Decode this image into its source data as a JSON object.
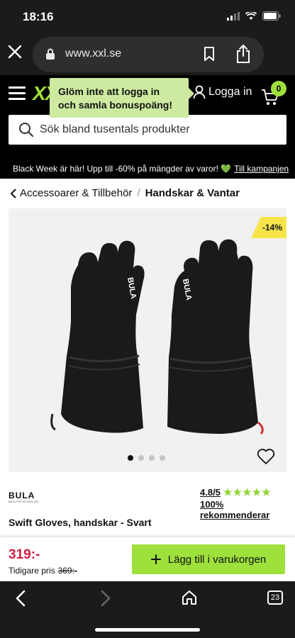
{
  "status_bar": {
    "time": "18:16"
  },
  "browser": {
    "url": "www.xxl.se",
    "tabs_count": "23"
  },
  "header": {
    "logo_text": "XX",
    "login_label": "Logga in",
    "cart_count": "0",
    "search_placeholder": "Sök bland tusentals produkter"
  },
  "tooltip": {
    "line1": "Glöm inte att logga in",
    "line2": "och samla bonuspoäng!"
  },
  "promo": {
    "text": "Black Week är här! Upp till -60% på mängder av varor! 💚",
    "link": "Till kampanjen"
  },
  "breadcrumb": {
    "parent": "Accessoarer & Tillbehör",
    "separator": "/",
    "current": "Handskar & Vantar"
  },
  "product": {
    "discount": "-14%",
    "brand": "BULA",
    "brand_tagline": "BUILD FOR THE GOOD LIFE",
    "rating": "4.8/5",
    "stars": "★★★★★",
    "recommend": "100% rekommenderar",
    "title": "Swift Gloves, handskar - Svart",
    "price": "319:-",
    "prev_price_label": "Tidigare pris",
    "prev_price": "369:-",
    "add_to_cart": "Lägg till i varukorgen",
    "image_count": 4,
    "active_image": 1
  },
  "colors": {
    "accent": "#9ee03c",
    "price": "#d21e44",
    "discount_bg": "#f7e44a",
    "tooltip_bg": "#cdeaa0"
  },
  "icons": [
    "close-icon",
    "lock-icon",
    "bookmark-icon",
    "share-icon",
    "menu-icon",
    "user-icon",
    "cart-icon",
    "search-icon",
    "chevron-left-icon",
    "heart-icon",
    "plus-icon",
    "back-arrow-icon",
    "forward-arrow-icon",
    "home-icon"
  ]
}
